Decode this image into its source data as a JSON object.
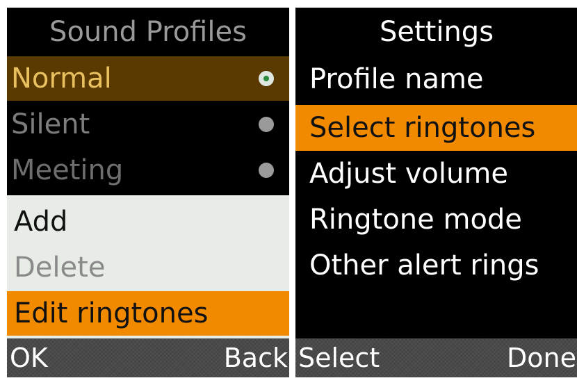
{
  "left": {
    "title": "Sound Profiles",
    "profiles": [
      {
        "label": "Normal",
        "selected": true
      },
      {
        "label": "Silent",
        "selected": false
      },
      {
        "label": "Meeting",
        "selected": false
      }
    ],
    "menu": [
      {
        "label": "Add",
        "enabled": true
      },
      {
        "label": "Delete",
        "enabled": false
      },
      {
        "label": "Edit ringtones",
        "highlighted": true
      }
    ],
    "softkeys": {
      "left": "OK",
      "right": "Back"
    }
  },
  "right": {
    "title": "Settings",
    "items": [
      "Profile name",
      "Select ringtones",
      "Adjust volume",
      "Ringtone mode",
      "Other alert rings"
    ],
    "highlighted_item": "Select ringtones",
    "softkeys": {
      "left": "Select",
      "right": "Done"
    }
  },
  "colors": {
    "accent": "#f28a00",
    "selected_row_dim": "#5a3a00",
    "dim_text": "#7d7d7d",
    "title_dim": "#999999",
    "popup_bg": "#e7ede6",
    "radio_selected_dot": "#2a8a3a"
  }
}
